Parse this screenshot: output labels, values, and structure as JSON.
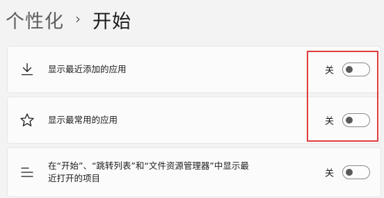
{
  "breadcrumb": {
    "parent": "个性化",
    "separator": "›",
    "current": "开始"
  },
  "settings": [
    {
      "icon": "download-icon",
      "label": "显示最近添加的应用",
      "state": "关",
      "on": false
    },
    {
      "icon": "star-icon",
      "label": "显示最常用的应用",
      "state": "关",
      "on": false
    },
    {
      "icon": "list-icon",
      "label": "在“开始”、“跳转列表”和“文件资源管理器”中显示最近打开的项目",
      "state": "关",
      "on": false
    }
  ],
  "colors": {
    "background": "#f3f3f3",
    "card": "#fbfbfb",
    "highlight": "#e03c3c"
  }
}
